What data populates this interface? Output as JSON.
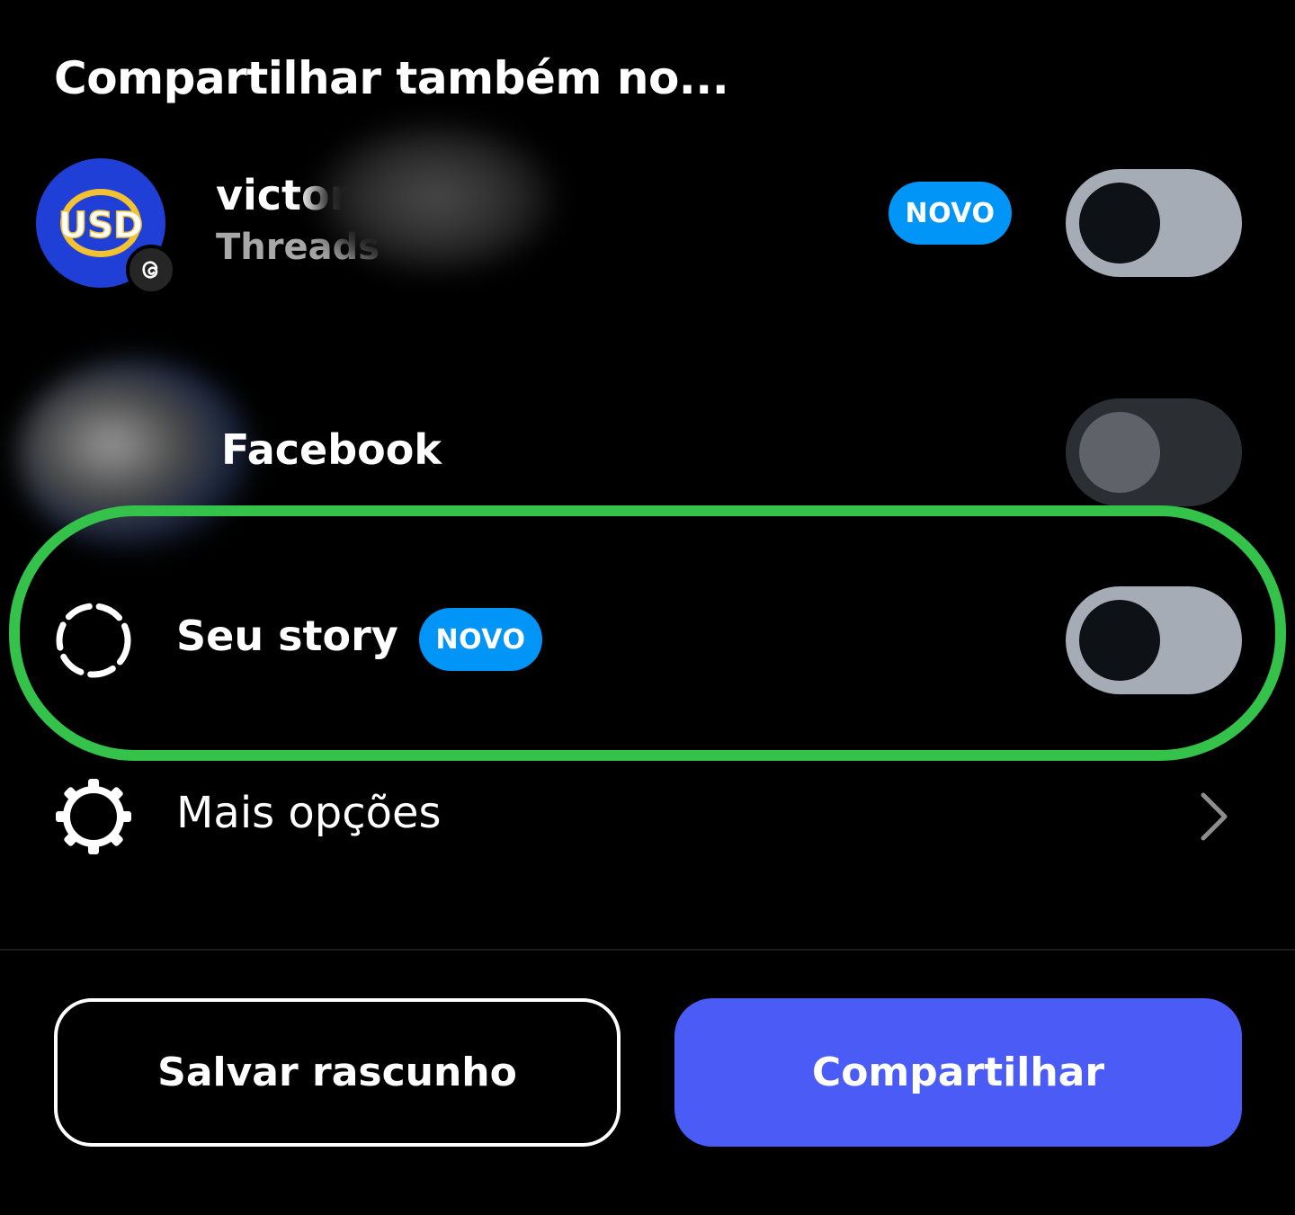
{
  "heading": "Compartilhar também no...",
  "threads_row": {
    "name": "victor",
    "platform": "Threads",
    "badge": "NOVO",
    "avatar_logo_text": "USD",
    "toggle_on": false
  },
  "facebook_row": {
    "label": "Facebook",
    "toggle_on": false,
    "toggle_enabled": false
  },
  "story_row": {
    "label": "Seu story",
    "badge": "NOVO",
    "toggle_on": false,
    "highlight_color": "#34c24a"
  },
  "more_row": {
    "label": "Mais opções"
  },
  "actions": {
    "draft_label": "Salvar rascunho",
    "share_label": "Compartilhar"
  },
  "colors": {
    "background": "#000000",
    "badge": "#0095f6",
    "primary_button": "#4a5cf5",
    "toggle_track": "#a5acb6",
    "avatar_blue": "#1f3fd6",
    "logo_gold": "#f2c230"
  },
  "icons": [
    "threads-icon",
    "story-ring-icon",
    "gear-icon",
    "chevron-right-icon"
  ]
}
